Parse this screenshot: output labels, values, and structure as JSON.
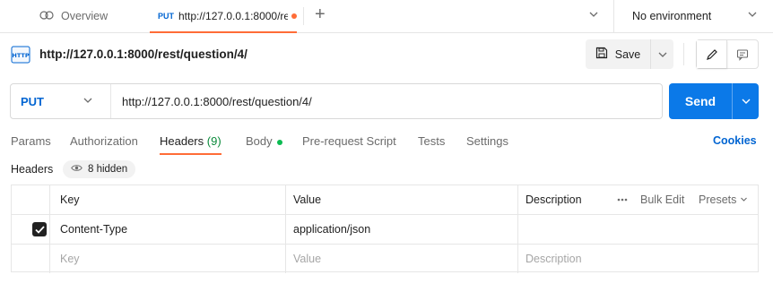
{
  "tabs": {
    "overview_label": "Overview",
    "active_method": "PUT",
    "active_url": "http://127.0.0.1:8000/rest/question/4/",
    "new_tab_icon": "plus-icon"
  },
  "environment": {
    "label": "No environment"
  },
  "request": {
    "title": "http://127.0.0.1:8000/rest/question/4/",
    "save_label": "Save",
    "method": "PUT",
    "url": "http://127.0.0.1:8000/rest/question/4/",
    "send_label": "Send"
  },
  "request_tabs": [
    {
      "label": "Params"
    },
    {
      "label": "Authorization"
    },
    {
      "label": "Headers",
      "count": "(9)"
    },
    {
      "label": "Body"
    },
    {
      "label": "Pre-request Script"
    },
    {
      "label": "Tests"
    },
    {
      "label": "Settings"
    }
  ],
  "cookies_label": "Cookies",
  "headers_section": {
    "label": "Headers",
    "hidden_label": "8 hidden"
  },
  "table": {
    "columns": {
      "key": "Key",
      "value": "Value",
      "description": "Description",
      "bulk_edit": "Bulk Edit",
      "presets": "Presets"
    },
    "rows": [
      {
        "checked": true,
        "key": "Content-Type",
        "value": "application/json",
        "description": ""
      }
    ],
    "placeholder": {
      "key": "Key",
      "value": "Value",
      "description": "Description"
    }
  },
  "colors": {
    "accent": "#ff6c37",
    "brand_blue": "#0b79e8",
    "method_blue": "#0265d2",
    "body_dot": "#0cbb52"
  }
}
